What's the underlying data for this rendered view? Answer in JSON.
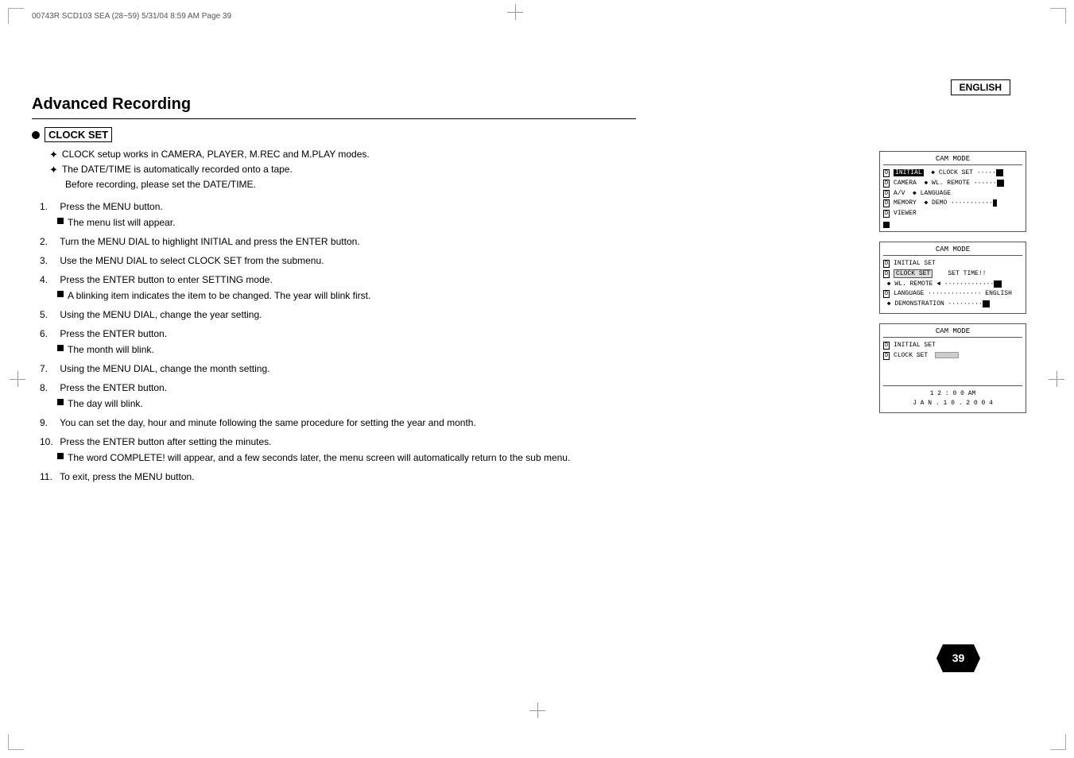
{
  "header": {
    "doc_info": "00743R SCD103 SEA (28~59)   5/31/04 8:59 AM   Page 39",
    "language_label": "ENGLISH"
  },
  "page": {
    "title": "Advanced Recording",
    "section_title": "CLOCK SET",
    "bullets": [
      "CLOCK setup works in CAMERA, PLAYER, M.REC and M.PLAY modes.",
      "The DATE/TIME is automatically recorded onto a tape.",
      "Before recording, please set the DATE/TIME."
    ],
    "steps": [
      {
        "num": "1.",
        "text": "Press the MENU button.",
        "sub": "The menu list will appear."
      },
      {
        "num": "2.",
        "text": "Turn the MENU DIAL to highlight INITIAL and press the ENTER button.",
        "sub": null
      },
      {
        "num": "3.",
        "text": "Use the MENU DIAL to select CLOCK SET from the submenu.",
        "sub": null
      },
      {
        "num": "4.",
        "text": "Press the ENTER button to enter SETTING mode.",
        "sub": "A blinking item indicates the item to be changed. The year will blink first."
      },
      {
        "num": "5.",
        "text": "Using the MENU DIAL, change the year setting.",
        "sub": null
      },
      {
        "num": "6.",
        "text": "Press the ENTER button.",
        "sub": "The month will blink."
      },
      {
        "num": "7.",
        "text": "Using the MENU DIAL, change the month setting.",
        "sub": null
      },
      {
        "num": "8.",
        "text": "Press the ENTER button.",
        "sub": "The day will blink."
      },
      {
        "num": "9.",
        "text": "You can set the day, hour and minute following the same procedure for setting the year and month.",
        "sub": null
      },
      {
        "num": "10.",
        "text": "Press the ENTER button after setting the minutes.",
        "sub": "The word COMPLETE! will appear, and a few seconds later, the menu screen will automatically return to the sub menu."
      },
      {
        "num": "11.",
        "text": "To exit, press the MENU button.",
        "sub": null
      }
    ],
    "page_number": "39"
  },
  "panels": [
    {
      "id": "panel1",
      "header": "CAM  MODE",
      "rows": [
        {
          "icon": "D",
          "label": "INITIAL",
          "highlight": "",
          "content": "◆ CLOCK  SET",
          "dots": "········",
          "bar": true
        },
        {
          "icon": "D",
          "label": "CAMERA",
          "content": "◆ WL. REMOTE",
          "dots": "·······",
          "bar": true
        },
        {
          "icon": "D",
          "label": "A/V",
          "content": "◆ LANGUAGE",
          "dots": ""
        },
        {
          "icon": "D",
          "label": "MEMORY",
          "content": "◆ DEMO",
          "dots": "···········",
          "xmark": true
        },
        {
          "icon": "D",
          "label": "VIEWER",
          "content": "",
          "dots": ""
        }
      ]
    },
    {
      "id": "panel2",
      "header": "CAM  MODE",
      "sub": "INITIAL SET",
      "rows": [
        {
          "highlight": true,
          "label": "CLOCK  SET",
          "content": "SET TIME!!"
        },
        {
          "label": "WL. REMOTE ◄",
          "dots": "·············",
          "bar": true
        },
        {
          "label": "LANGUAGE",
          "dots": "··············",
          "content": "ENGLISH"
        },
        {
          "label": "DEMONSTRATION",
          "dots": "·········",
          "xmark": true
        }
      ]
    },
    {
      "id": "panel3",
      "header": "CAM  MODE",
      "sub": "INITIAL SET",
      "clock_set": "CLOCK  SET",
      "time": "1 2 : 0 0 AM",
      "date": "J A N . 1 0 . 2 0 0 4"
    }
  ],
  "icons": {
    "bullet": "●",
    "dagger": "✦",
    "black_square": "■",
    "triangle": "▶"
  }
}
